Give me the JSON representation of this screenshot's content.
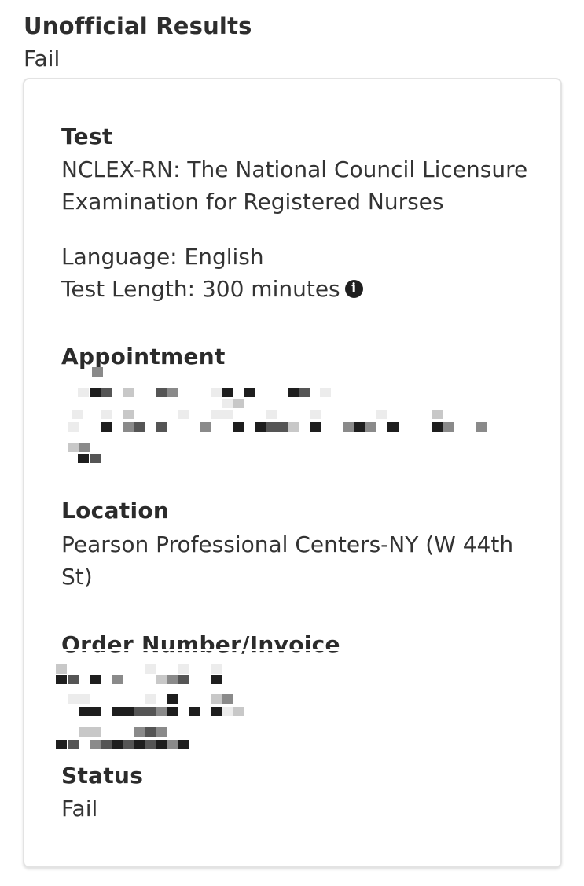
{
  "header": {
    "title": "Unofficial Results",
    "result": "Fail"
  },
  "card": {
    "test": {
      "heading": "Test",
      "line1": "NCLEX-RN: The National Council Licensure",
      "line2": "Examination for Registered Nurses",
      "language": "Language:  English",
      "length": "Test Length: 300 minutes",
      "info_icon": "info-icon"
    },
    "appointment": {
      "heading": "Appointment"
    },
    "location": {
      "heading": "Location",
      "line1": "Pearson Professional Centers-NY (W 44th",
      "line2": "St)"
    },
    "order": {
      "heading": "Order Number/Invoice"
    },
    "status": {
      "heading": "Status",
      "value": "Fail"
    }
  }
}
